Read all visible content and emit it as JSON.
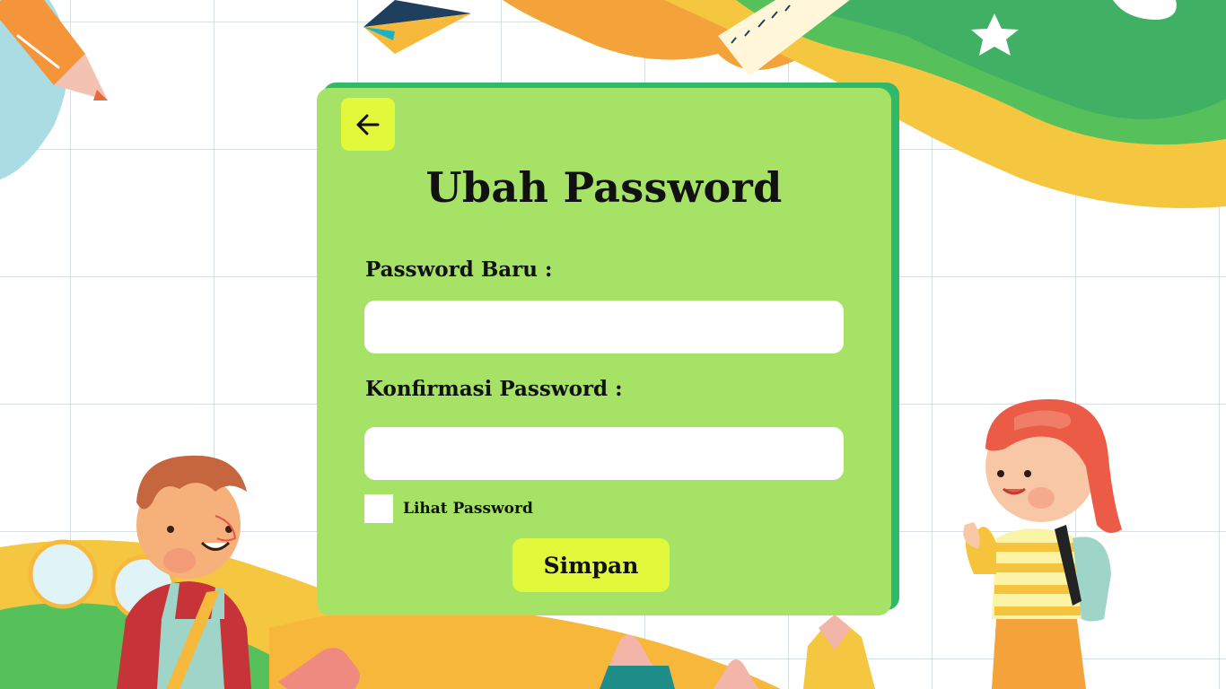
{
  "page": {
    "title": "Ubah Password"
  },
  "navigation": {
    "back_icon": "arrow-left-icon"
  },
  "form": {
    "new_password_label": "Password Baru :",
    "new_password_value": "",
    "confirm_password_label": "Konfirmasi Password :",
    "confirm_password_value": "",
    "show_password_label": "Lihat Password",
    "show_password_checked": false,
    "submit_label": "Simpan"
  },
  "colors": {
    "card": "#a6e265",
    "card_shadow": "#2fba6b",
    "button": "#e2f83a",
    "input": "#ffffff"
  }
}
